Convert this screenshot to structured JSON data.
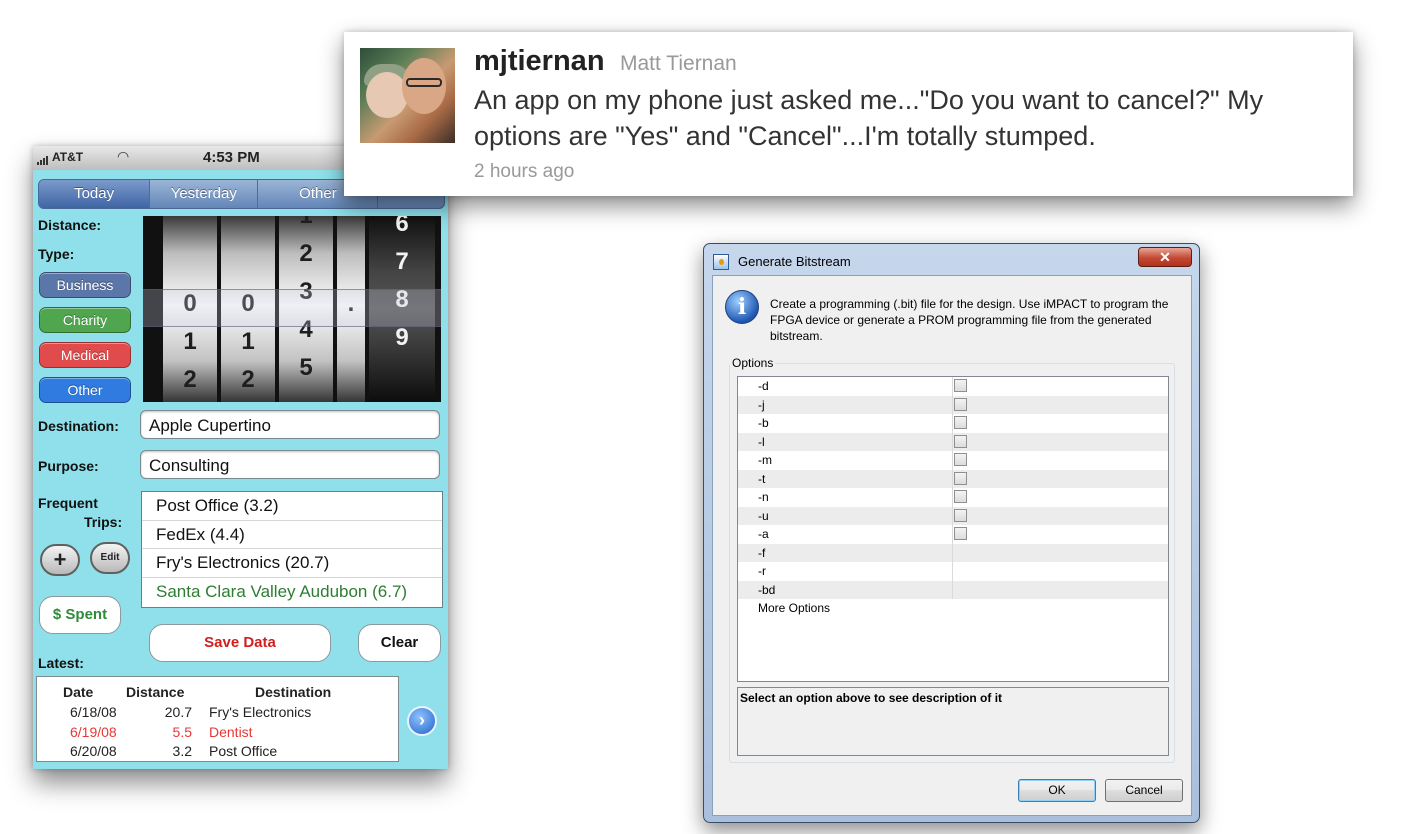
{
  "phone": {
    "status": {
      "carrier": "AT&T",
      "time": "4:53 PM"
    },
    "tabs": [
      "Today",
      "Yesterday",
      "Other"
    ],
    "labels": {
      "distance": "Distance:",
      "type": "Type:",
      "destination": "Destination:",
      "purpose": "Purpose:",
      "frequent": "Frequent",
      "trips": "Trips:",
      "latest": "Latest:"
    },
    "type_buttons": [
      "Business",
      "Charity",
      "Medical",
      "Other"
    ],
    "type_colors": {
      "business": "#5b76a8",
      "charity": "#4fa64f",
      "medical": "#e24b4b",
      "other": "#2f7be0"
    },
    "picker": {
      "wheels": [
        [
          "",
          "0",
          "1",
          "2"
        ],
        [
          "",
          "0",
          "1",
          "2"
        ],
        [
          "1",
          "2",
          "3",
          "4",
          "5"
        ],
        [
          "",
          "."
        ],
        [
          "6",
          "7",
          "8",
          "9"
        ]
      ],
      "selected_value": "003.8"
    },
    "destination_value": "Apple Cupertino",
    "purpose_value": "Consulting",
    "frequent_trips": [
      {
        "label": "Post Office (3.2)",
        "color": "#111111"
      },
      {
        "label": "FedEx (4.4)",
        "color": "#111111"
      },
      {
        "label": "Fry's Electronics (20.7)",
        "color": "#111111"
      },
      {
        "label": "Santa Clara Valley Audubon (6.7)",
        "color": "#2e7d32"
      }
    ],
    "add_icon": "plus-icon",
    "edit_label": "Edit",
    "spent_label": "$ Spent",
    "save_label": "Save Data",
    "clear_label": "Clear",
    "latest_headers": {
      "date": "Date",
      "distance": "Distance",
      "destination": "Destination"
    },
    "latest_rows": [
      {
        "date": "6/18/08",
        "distance": "20.7",
        "destination": "Fry's Electronics",
        "color": "#222222"
      },
      {
        "date": "6/19/08",
        "distance": "5.5",
        "destination": "Dentist",
        "color": "#e53935"
      },
      {
        "date": "6/20/08",
        "distance": "3.2",
        "destination": "Post Office",
        "color": "#222222"
      }
    ],
    "next_icon": "chevron-right-circle-icon"
  },
  "tweet": {
    "username": "mjtiernan",
    "fullname": "Matt Tiernan",
    "text": "An app on my phone just asked me...\"Do you want to cancel?\" My options are \"Yes\" and \"Cancel\"...I'm totally stumped.",
    "time": "2 hours ago"
  },
  "dialog": {
    "title": "Generate Bitstream",
    "message": "Create a programming (.bit) file for the design. Use iMPACT to program the FPGA device or generate a PROM programming file from the generated bitstream.",
    "options_label": "Options",
    "options": [
      {
        "name": "-d",
        "checkbox": true
      },
      {
        "name": "-j",
        "checkbox": true
      },
      {
        "name": "-b",
        "checkbox": true
      },
      {
        "name": "-l",
        "checkbox": true
      },
      {
        "name": "-m",
        "checkbox": true
      },
      {
        "name": "-t",
        "checkbox": true
      },
      {
        "name": "-n",
        "checkbox": true
      },
      {
        "name": "-u",
        "checkbox": true
      },
      {
        "name": "-a",
        "checkbox": true
      },
      {
        "name": "-f",
        "checkbox": false
      },
      {
        "name": "-r",
        "checkbox": false
      },
      {
        "name": "-bd",
        "checkbox": false
      },
      {
        "name": "More Options",
        "checkbox": false
      }
    ],
    "description": "Select an option above to see description of it",
    "ok_label": "OK",
    "cancel_label": "Cancel",
    "close_glyph": "✕"
  }
}
